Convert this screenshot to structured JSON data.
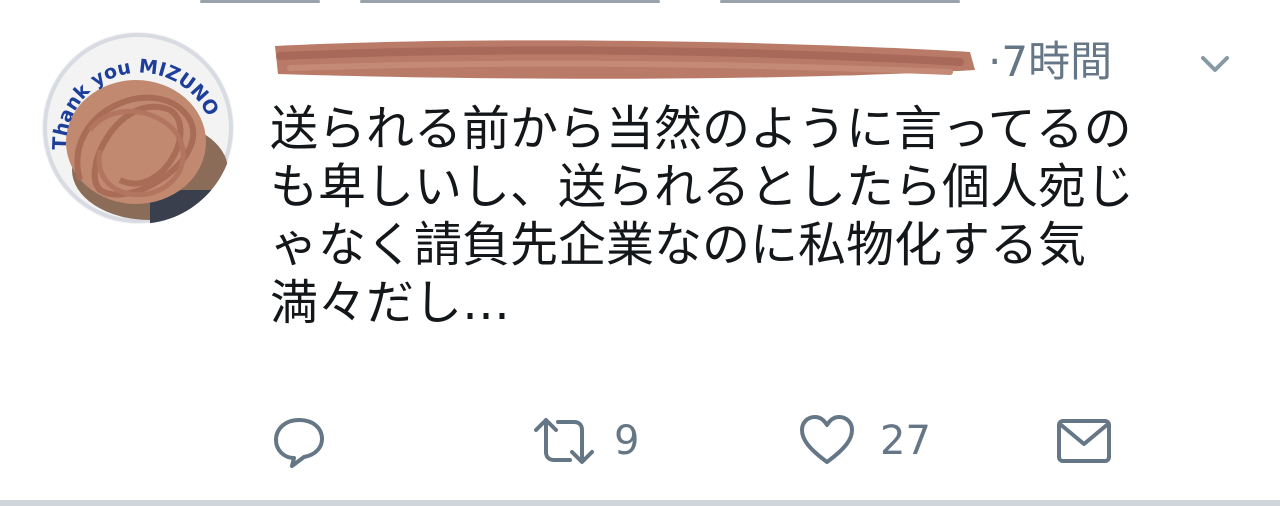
{
  "tweet": {
    "avatar_badge_text": "Thank you MIZUNO",
    "timestamp": "·7時間",
    "body_lines": [
      "送られる前から当然のように言ってるの",
      "も卑しいし、送られるとしたら個人宛じ",
      "ゃなく請負先企業なのに私物化する気",
      "満々だし…"
    ]
  },
  "actions": {
    "reply_count": "",
    "retweet_count": "9",
    "like_count": "27"
  },
  "colors": {
    "text": "#14171a",
    "secondary": "#657786",
    "redaction": "#b97a68",
    "badge_blue": "#1d3f9a"
  },
  "icons": [
    "avatar",
    "chevron-down-icon",
    "reply-icon",
    "retweet-icon",
    "heart-icon",
    "message-icon"
  ]
}
